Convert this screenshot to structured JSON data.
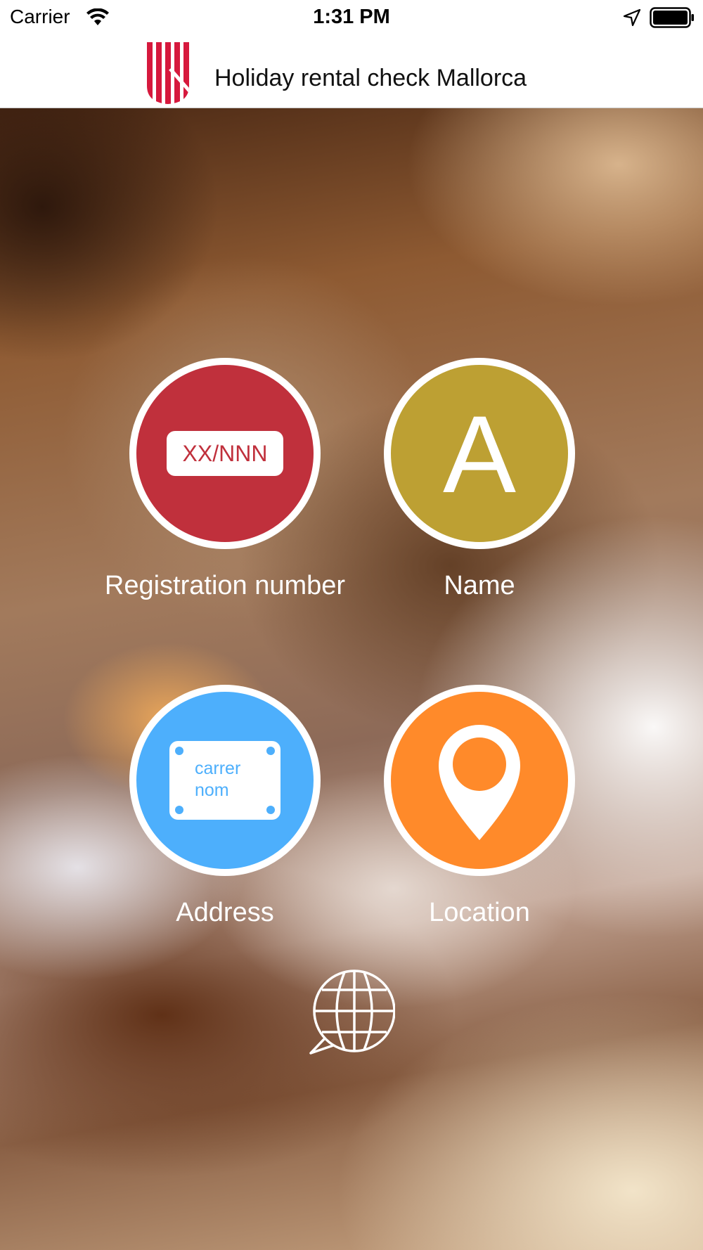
{
  "status_bar": {
    "carrier": "Carrier",
    "time": "1:31 PM",
    "icons": [
      "wifi-icon",
      "location-arrow-icon",
      "battery-icon"
    ]
  },
  "header": {
    "title": "Holiday rental check Mallorca",
    "logo": "govern-illes-balears-logo",
    "logo_color": "#d6193d"
  },
  "menu": {
    "items": [
      {
        "id": "registration",
        "label": "Registration number",
        "icon_text": "XX/NNN",
        "color": "#c0303c"
      },
      {
        "id": "name",
        "label": "Name",
        "icon_text": "A",
        "color": "#bda033"
      },
      {
        "id": "address",
        "label": "Address",
        "icon_text_line1": "carrer",
        "icon_text_line2": "nom",
        "color": "#4daffc"
      },
      {
        "id": "location",
        "label": "Location",
        "icon": "map-pin-icon",
        "color": "#ff8a2a"
      }
    ]
  },
  "footer": {
    "language_icon": "globe-speech-bubble-icon"
  }
}
